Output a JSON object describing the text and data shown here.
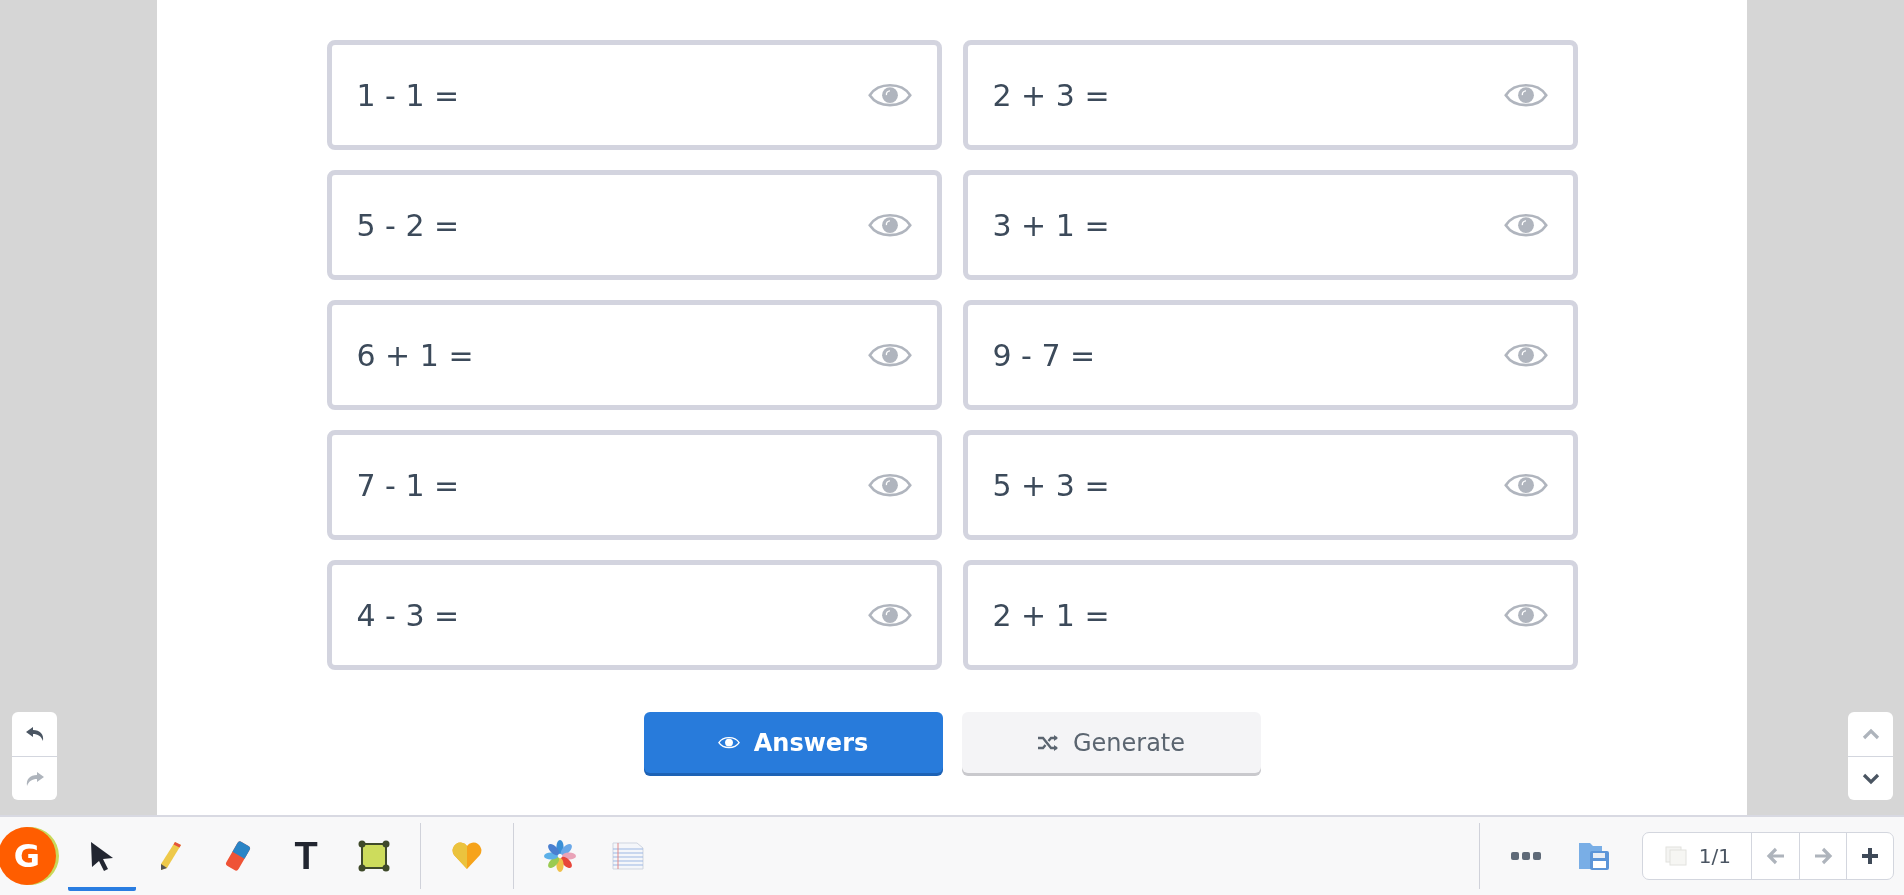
{
  "problems": [
    {
      "text": "1 - 1 =",
      "answer_shown": false
    },
    {
      "text": "2 + 3 =",
      "answer_shown": false
    },
    {
      "text": "5 - 2 =",
      "answer_shown": false
    },
    {
      "text": "3 + 1 =",
      "answer_shown": false
    },
    {
      "text": "6 + 1 =",
      "answer_shown": false
    },
    {
      "text": "9 - 7 =",
      "answer_shown": false
    },
    {
      "text": "7 - 1 =",
      "answer_shown": false
    },
    {
      "text": "5 + 3 =",
      "answer_shown": false
    },
    {
      "text": "4 - 3 =",
      "answer_shown": false
    },
    {
      "text": "2 + 1 =",
      "answer_shown": false
    }
  ],
  "actions": [
    {
      "kind": "answers",
      "label": "Answers"
    },
    {
      "kind": "generate",
      "label": "Generate"
    }
  ],
  "history": {
    "undo_disabled": false,
    "redo_disabled": true
  },
  "scroll": {
    "up_disabled": true,
    "down_disabled": false
  },
  "toolbar": {
    "logo": "G",
    "tools": [
      {
        "kind": "select",
        "selected": true
      },
      {
        "kind": "pencil",
        "selected": false
      },
      {
        "kind": "eraser",
        "selected": false
      },
      {
        "kind": "text",
        "label": "T",
        "selected": false
      },
      {
        "kind": "shape",
        "selected": false
      }
    ],
    "extras": [
      {
        "kind": "heart"
      },
      {
        "kind": "flower"
      },
      {
        "kind": "notebook"
      }
    ],
    "pages": {
      "current": "1/1",
      "prev_disabled": true,
      "next_disabled": true
    }
  }
}
